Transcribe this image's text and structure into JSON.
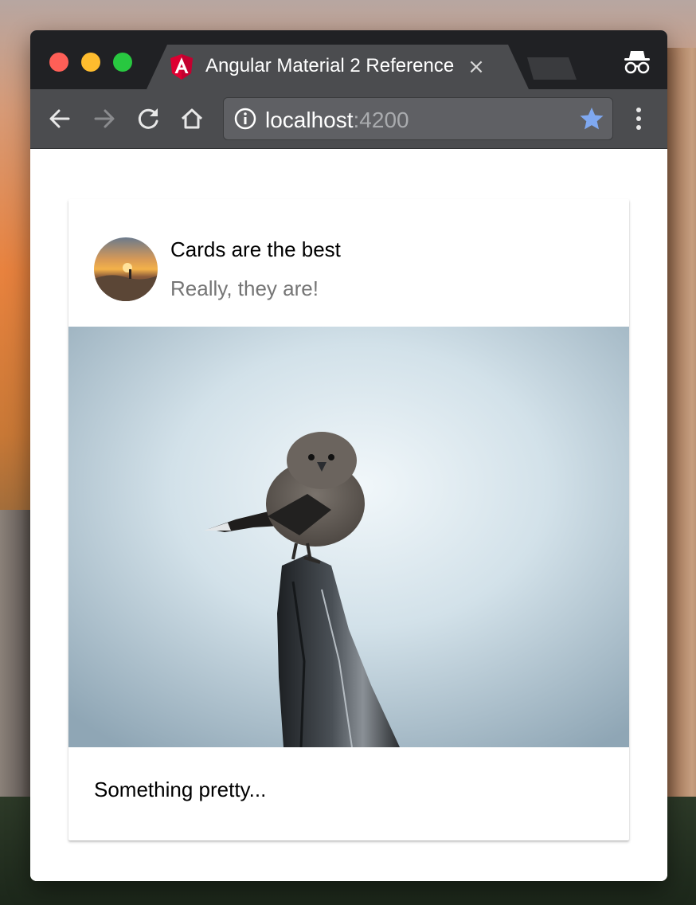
{
  "browser": {
    "tab": {
      "title": "Angular Material 2 Reference",
      "close_glyph": "×",
      "logo_icon": "angular-logo-icon"
    },
    "address_bar": {
      "host": "localhost",
      "port": ":4200"
    },
    "icons": {
      "back": "back-arrow-icon",
      "forward": "forward-arrow-icon",
      "reload": "reload-icon",
      "home": "home-icon",
      "info": "info-icon",
      "bookmark": "star-icon",
      "menu": "kebab-menu-icon",
      "incognito": "incognito-icon"
    },
    "colors": {
      "titlebar": "#202124",
      "toolbar": "#4b4c4f",
      "bookmark_star": "#7fa8f0",
      "angular_red": "#dd0031"
    }
  },
  "card": {
    "title": "Cards are the best",
    "subtitle": "Really, they are!",
    "content": "Something pretty..."
  }
}
